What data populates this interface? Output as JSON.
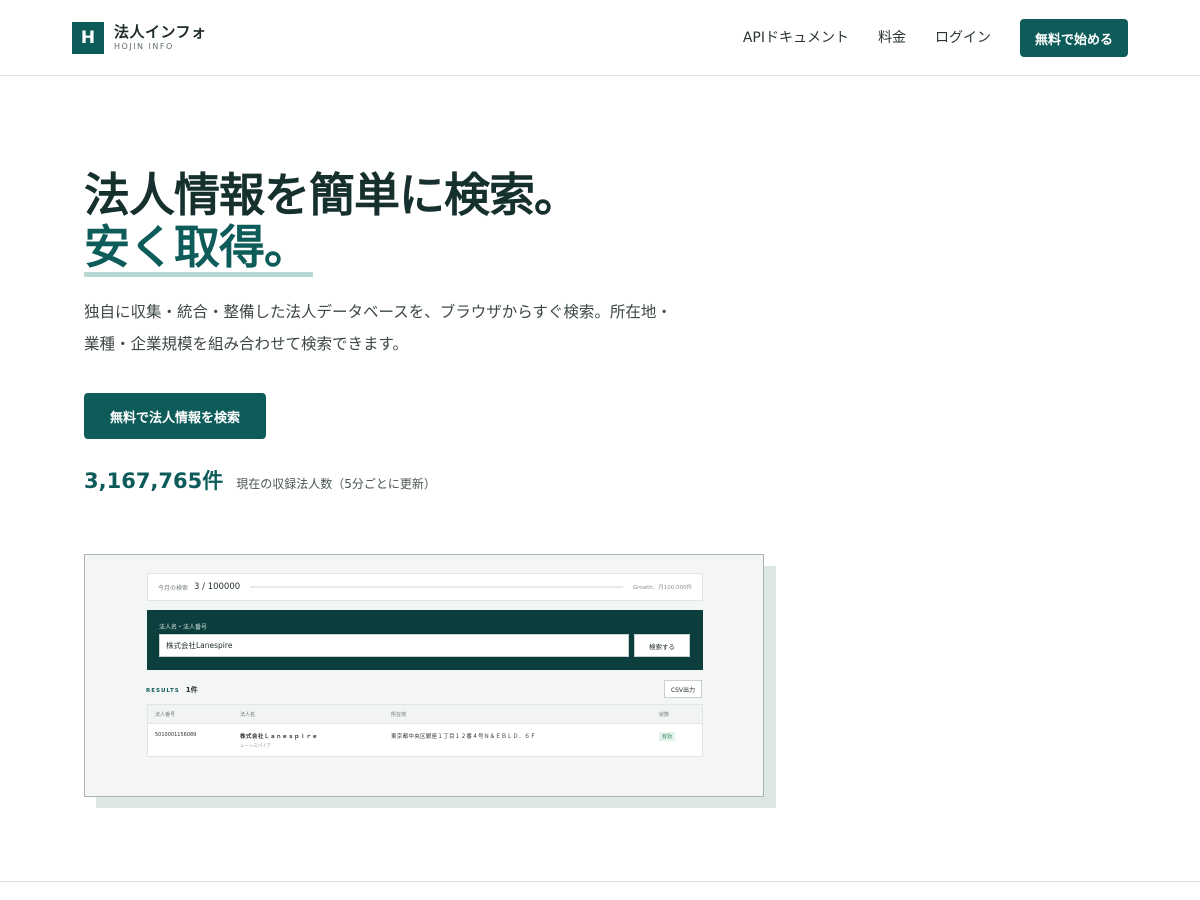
{
  "header": {
    "logo_mark": "H",
    "logo_name": "法人インフォ",
    "logo_sub": "HOJIN INFO",
    "nav": [
      "APIドキュメント",
      "料金",
      "ログイン"
    ],
    "cta": "無料で始める"
  },
  "hero": {
    "title_line1": "法人情報を簡単に検索。",
    "title_line2": "安く取得。",
    "description": "独自に収集・統合・整備した法人データベースを、ブラウザからすぐ検索。所在地・業種・企業規模を組み合わせて検索できます。",
    "button": "無料で法人情報を検索",
    "count": "3,167,765件",
    "count_label": "現在の収録法人数（5分ごとに更新）"
  },
  "preview": {
    "usage_label": "今月の検索",
    "usage_value": "3 / 100000",
    "usage_growth": "Growth：月100,000件",
    "search_label": "法人名・法人番号",
    "search_value": "株式会社Lanespire",
    "search_button": "検索する",
    "results_label": "RESULTS",
    "results_count": "1件",
    "csv_button": "CSV出力",
    "table_headers": [
      "法人番号",
      "法人名",
      "所在地",
      "状態"
    ],
    "row": {
      "number": "5010001156089",
      "name": "株式会社Ｌａｎｅｓｐｉｒｅ",
      "kana": "レーンスパイア",
      "address": "東京都中央区銀座１丁目１２番４号Ｎ＆ＥＢＬＤ．６Ｆ",
      "status": "有効"
    }
  },
  "colors": {
    "primary": "#0d5c5a",
    "dark": "#0b3e3d",
    "accent_underline": "#b7d7d2"
  }
}
